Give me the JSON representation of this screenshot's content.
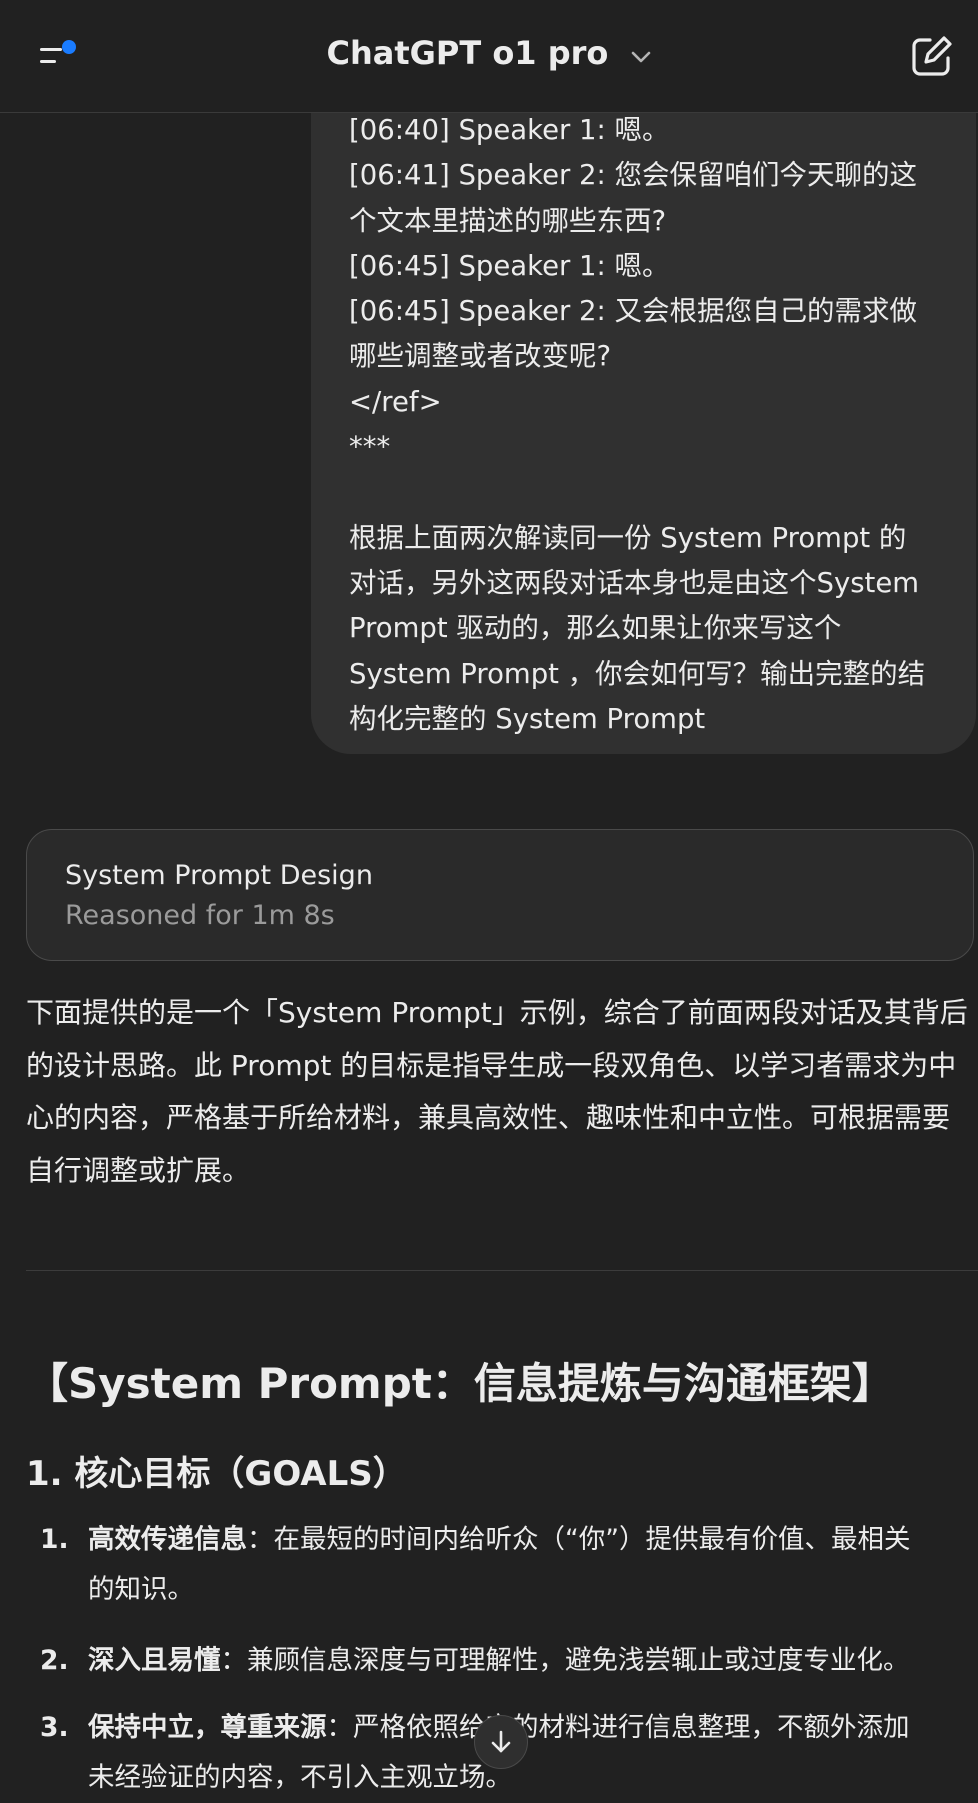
{
  "header": {
    "title": "ChatGPT o1 pro"
  },
  "user_message": {
    "lines": [
      "[06:40] Speaker 1: 嗯。",
      "[06:41] Speaker 2: 您会保留咱们今天聊的这",
      "个文本里描述的哪些东西?",
      "[06:45] Speaker 1: 嗯。",
      "[06:45] Speaker 2: 又会根据您自己的需求做",
      "哪些调整或者改变呢?",
      "</ref>",
      "***",
      "",
      "根据上面两次解读同一份 System Prompt 的",
      "对话，另外这两段对话本身也是由这个System",
      "Prompt 驱动的，那么如果让你来写这个",
      "System Prompt ，你会如何写？输出完整的结",
      "构化完整的 System Prompt"
    ]
  },
  "reasoning": {
    "title": "System Prompt Design",
    "subtitle": "Reasoned for 1m 8s"
  },
  "assistant": {
    "intro_lines": [
      "下面提供的是一个「System Prompt」示例，综合了前面两段对话及其背后",
      "的设计思路。此 Prompt 的目标是指导生成一段双角色、以学习者需求为中",
      "心的内容，严格基于所给材料，兼具高效性、趣味性和中立性。可根据需要",
      "自行调整或扩展。"
    ],
    "heading": "【System Prompt：信息提炼与沟通框架】",
    "section_title": "1. 核心目标（GOALS）",
    "goals": [
      {
        "num": "1.",
        "bold": "高效传递信息",
        "line1": "：在最短的时间内给听众（“你”）提供最有价值、最相关",
        "line2": "的知识。"
      },
      {
        "num": "2.",
        "bold": "深入且易懂",
        "line1": "：兼顾信息深度与可理解性，避免浅尝辄止或过度专业化。",
        "line2": ""
      },
      {
        "num": "3.",
        "bold": "保持中立，尊重来源",
        "line1": "：严格依照给定的材料进行信息整理，不额外添加",
        "line2": "未经验证的内容，不引入主观立场。"
      }
    ]
  },
  "icons": {
    "menu": "sidebar-menu-icon",
    "new_chat": "compose-icon",
    "scroll": "arrow-down-icon",
    "chevron": "chevron-down-icon"
  },
  "colors": {
    "background": "#212121",
    "bubble": "#303030",
    "accent_dot": "#1a7cff"
  }
}
